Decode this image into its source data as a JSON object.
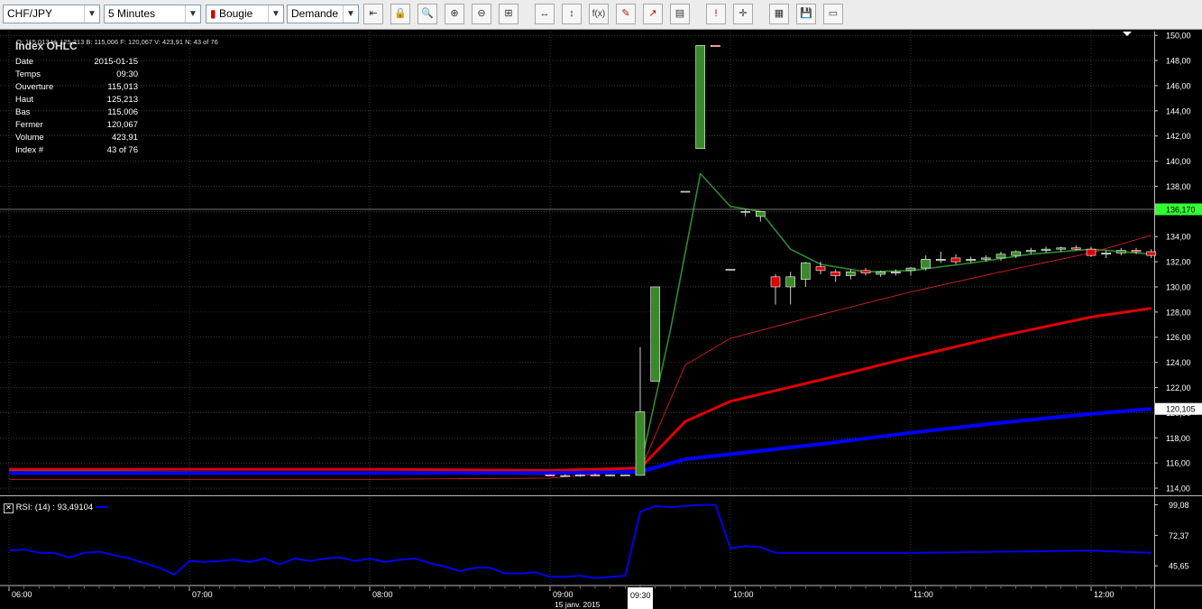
{
  "toolbar": {
    "symbol": "CHF/JPY",
    "timeframe": "5 Minutes",
    "chart_type": "Bougie",
    "price_side": "Demande"
  },
  "info_bar": "O: 115,013 H: 125,213 B: 115,006 F: 120,067 V: 423,91 N: 43 of 76",
  "ohlc_title": "Index OHLC",
  "ohlc_rows": [
    {
      "label": "Date",
      "value": "2015-01-15"
    },
    {
      "label": "Temps",
      "value": "09:30"
    },
    {
      "label": "Ouverture",
      "value": "115,013"
    },
    {
      "label": "Haut",
      "value": "125,213"
    },
    {
      "label": "Bas",
      "value": "115,006"
    },
    {
      "label": "Fermer",
      "value": "120,067"
    },
    {
      "label": "Volume",
      "value": "423,91"
    },
    {
      "label": "Index #",
      "value": "43 of 76"
    }
  ],
  "crosshair_price": "136,170",
  "last_price": "120,105",
  "rsi_label": "RSI: (14) : 93,49104",
  "cursor_time": "09:30",
  "date_label": "15 janv. 2015",
  "colors": {
    "up": "#3a8a2a",
    "down": "#e00000",
    "ma_green": "#2e8b2e",
    "ma_thin_red": "#d42020",
    "ma_red": "#e00000",
    "ma_blue": "#0000ff",
    "rsi": "#0000ee",
    "grid": "#5a5a5a",
    "highlight": "#33ff33"
  },
  "chart_data": [
    {
      "type": "candlestick",
      "x_unit": "time (5-minute bars)",
      "x_ticks": [
        "06:00",
        "07:00",
        "08:00",
        "09:00",
        "10:00",
        "11:00",
        "12:00"
      ],
      "y_ticks": [
        "114,00",
        "116,00",
        "118,00",
        "120,00",
        "122,00",
        "124,00",
        "126,00",
        "128,00",
        "130,00",
        "132,00",
        "134,00",
        "136,00",
        "138,00",
        "140,00",
        "142,00",
        "144,00",
        "146,00",
        "148,00",
        "150,00"
      ],
      "ylim": [
        113.5,
        150.3
      ],
      "grid": true,
      "candles": [
        {
          "t": "09:00",
          "o": 115.05,
          "h": 115.1,
          "l": 114.95,
          "c": 115.0
        },
        {
          "t": "09:05",
          "o": 115.0,
          "h": 115.1,
          "l": 114.9,
          "c": 115.0
        },
        {
          "t": "09:10",
          "o": 115.0,
          "h": 115.1,
          "l": 114.9,
          "c": 115.05
        },
        {
          "t": "09:15",
          "o": 115.05,
          "h": 115.15,
          "l": 114.95,
          "c": 115.0
        },
        {
          "t": "09:20",
          "o": 115.0,
          "h": 115.1,
          "l": 114.95,
          "c": 115.05
        },
        {
          "t": "09:25",
          "o": 115.05,
          "h": 115.1,
          "l": 115.0,
          "c": 115.05
        },
        {
          "t": "09:30",
          "o": 115.013,
          "h": 125.213,
          "l": 115.006,
          "c": 120.067
        },
        {
          "t": "09:35",
          "o": 122.5,
          "h": 126.6,
          "l": 122.5,
          "c": 130.0
        },
        {
          "t": "09:45",
          "o": 137.6,
          "h": 137.6,
          "l": 137.6,
          "c": 137.6
        },
        {
          "t": "09:50",
          "o": 141.0,
          "h": 149.2,
          "l": 141.0,
          "c": 149.2
        },
        {
          "t": "09:55",
          "o": 149.2,
          "h": 149.2,
          "l": 149.1,
          "c": 149.1
        },
        {
          "t": "10:00",
          "o": 131.4,
          "h": 131.4,
          "l": 131.4,
          "c": 131.4
        },
        {
          "t": "10:05",
          "o": 136.0,
          "h": 136.2,
          "l": 135.6,
          "c": 136.0
        },
        {
          "t": "10:10",
          "o": 135.6,
          "h": 136.0,
          "l": 135.2,
          "c": 136.0
        },
        {
          "t": "10:15",
          "o": 130.8,
          "h": 131.0,
          "l": 128.6,
          "c": 130.0
        },
        {
          "t": "10:20",
          "o": 130.0,
          "h": 131.2,
          "l": 128.6,
          "c": 130.8
        },
        {
          "t": "10:25",
          "o": 130.6,
          "h": 132.0,
          "l": 130.0,
          "c": 131.9
        },
        {
          "t": "10:30",
          "o": 131.6,
          "h": 132.0,
          "l": 131.0,
          "c": 131.3
        },
        {
          "t": "10:35",
          "o": 131.2,
          "h": 131.4,
          "l": 130.4,
          "c": 130.9
        },
        {
          "t": "10:40",
          "o": 130.9,
          "h": 131.4,
          "l": 130.6,
          "c": 131.2
        },
        {
          "t": "10:45",
          "o": 131.3,
          "h": 131.5,
          "l": 130.9,
          "c": 131.1
        },
        {
          "t": "10:50",
          "o": 131.0,
          "h": 131.3,
          "l": 130.8,
          "c": 131.2
        },
        {
          "t": "10:55",
          "o": 131.1,
          "h": 131.4,
          "l": 130.9,
          "c": 131.2
        },
        {
          "t": "11:00",
          "o": 131.3,
          "h": 131.6,
          "l": 130.9,
          "c": 131.5
        },
        {
          "t": "11:05",
          "o": 131.5,
          "h": 132.5,
          "l": 131.3,
          "c": 132.2
        },
        {
          "t": "11:10",
          "o": 132.1,
          "h": 132.8,
          "l": 131.9,
          "c": 132.2
        },
        {
          "t": "11:15",
          "o": 132.3,
          "h": 132.6,
          "l": 131.8,
          "c": 132.0
        },
        {
          "t": "11:20",
          "o": 132.1,
          "h": 132.4,
          "l": 131.9,
          "c": 132.2
        },
        {
          "t": "11:25",
          "o": 132.2,
          "h": 132.5,
          "l": 132.0,
          "c": 132.3
        },
        {
          "t": "11:30",
          "o": 132.3,
          "h": 132.8,
          "l": 132.1,
          "c": 132.6
        },
        {
          "t": "11:35",
          "o": 132.5,
          "h": 132.9,
          "l": 132.3,
          "c": 132.8
        },
        {
          "t": "11:40",
          "o": 132.8,
          "h": 133.1,
          "l": 132.6,
          "c": 132.9
        },
        {
          "t": "11:45",
          "o": 132.9,
          "h": 133.2,
          "l": 132.7,
          "c": 133.0
        },
        {
          "t": "11:50",
          "o": 133.0,
          "h": 133.2,
          "l": 132.8,
          "c": 133.1
        },
        {
          "t": "11:55",
          "o": 133.1,
          "h": 133.3,
          "l": 132.9,
          "c": 133.0
        },
        {
          "t": "12:00",
          "o": 133.0,
          "h": 133.2,
          "l": 132.4,
          "c": 132.5
        },
        {
          "t": "12:05",
          "o": 132.6,
          "h": 132.9,
          "l": 132.3,
          "c": 132.7
        },
        {
          "t": "12:10",
          "o": 132.7,
          "h": 133.1,
          "l": 132.5,
          "c": 132.9
        },
        {
          "t": "12:15",
          "o": 132.9,
          "h": 133.1,
          "l": 132.6,
          "c": 132.8
        },
        {
          "t": "12:20",
          "o": 132.8,
          "h": 133.0,
          "l": 132.3,
          "c": 132.5
        }
      ],
      "overlays": [
        {
          "color": "#2e8b2e",
          "width": 1.6,
          "points": [
            [
              "06:00",
              115.4
            ],
            [
              "07:00",
              115.3
            ],
            [
              "08:00",
              115.2
            ],
            [
              "09:00",
              115.1
            ],
            [
              "09:30",
              115.6
            ],
            [
              "09:40",
              126.5
            ],
            [
              "09:50",
              139.0
            ],
            [
              "10:00",
              136.4
            ],
            [
              "10:10",
              136.0
            ],
            [
              "10:20",
              133.0
            ],
            [
              "10:30",
              131.8
            ],
            [
              "10:45",
              131.2
            ],
            [
              "11:00",
              131.3
            ],
            [
              "11:20",
              131.9
            ],
            [
              "11:40",
              132.6
            ],
            [
              "12:00",
              133.0
            ],
            [
              "12:20",
              132.6
            ]
          ]
        },
        {
          "color": "#d42020",
          "width": 0.9,
          "points": [
            [
              "06:00",
              114.7
            ],
            [
              "07:00",
              114.7
            ],
            [
              "08:00",
              114.7
            ],
            [
              "09:00",
              114.8
            ],
            [
              "09:30",
              115.4
            ],
            [
              "09:45",
              123.8
            ],
            [
              "10:00",
              125.9
            ],
            [
              "10:30",
              127.8
            ],
            [
              "11:00",
              129.6
            ],
            [
              "11:30",
              131.2
            ],
            [
              "12:00",
              132.7
            ],
            [
              "12:20",
              134.1
            ]
          ]
        },
        {
          "color": "#e00000",
          "width": 3,
          "points": [
            [
              "06:00",
              115.5
            ],
            [
              "07:00",
              115.5
            ],
            [
              "08:00",
              115.5
            ],
            [
              "09:00",
              115.4
            ],
            [
              "09:30",
              115.6
            ],
            [
              "09:45",
              119.3
            ],
            [
              "10:00",
              120.9
            ],
            [
              "10:30",
              122.6
            ],
            [
              "11:00",
              124.4
            ],
            [
              "11:30",
              126.1
            ],
            [
              "12:00",
              127.6
            ],
            [
              "12:20",
              128.3
            ]
          ]
        },
        {
          "color": "#0000ff",
          "width": 4,
          "points": [
            [
              "06:00",
              115.2
            ],
            [
              "07:00",
              115.2
            ],
            [
              "08:00",
              115.2
            ],
            [
              "09:00",
              115.2
            ],
            [
              "09:30",
              115.3
            ],
            [
              "09:45",
              116.3
            ],
            [
              "10:00",
              116.7
            ],
            [
              "10:30",
              117.5
            ],
            [
              "11:00",
              118.4
            ],
            [
              "11:30",
              119.2
            ],
            [
              "12:00",
              119.9
            ],
            [
              "12:20",
              120.3
            ]
          ]
        }
      ],
      "crosshair": {
        "time": "09:30",
        "price": 136.17
      }
    },
    {
      "type": "line",
      "x_ticks": [
        "06:00",
        "07:00",
        "08:00",
        "09:00",
        "10:00",
        "11:00",
        "12:00"
      ],
      "y_ticks": [
        "99,08",
        "72,37",
        "45,65"
      ],
      "ylim": [
        30,
        105
      ],
      "series": [
        {
          "name": "RSI: (14)",
          "color": "#0000ee",
          "points": [
            [
              "06:00",
              59
            ],
            [
              "06:05",
              60
            ],
            [
              "06:10",
              57
            ],
            [
              "06:15",
              57
            ],
            [
              "06:20",
              53
            ],
            [
              "06:25",
              57
            ],
            [
              "06:30",
              58
            ],
            [
              "06:35",
              55
            ],
            [
              "06:40",
              52
            ],
            [
              "06:45",
              48
            ],
            [
              "06:50",
              44
            ],
            [
              "06:55",
              38
            ],
            [
              "07:00",
              50
            ],
            [
              "07:05",
              49
            ],
            [
              "07:10",
              50
            ],
            [
              "07:15",
              51
            ],
            [
              "07:20",
              49
            ],
            [
              "07:25",
              52
            ],
            [
              "07:30",
              47
            ],
            [
              "07:35",
              52
            ],
            [
              "07:40",
              50
            ],
            [
              "07:45",
              52
            ],
            [
              "07:50",
              53
            ],
            [
              "07:55",
              50
            ],
            [
              "08:00",
              52
            ],
            [
              "08:05",
              49
            ],
            [
              "08:10",
              51
            ],
            [
              "08:15",
              52
            ],
            [
              "08:20",
              48
            ],
            [
              "08:25",
              45
            ],
            [
              "08:30",
              41
            ],
            [
              "08:35",
              44
            ],
            [
              "08:40",
              44
            ],
            [
              "08:45",
              39
            ],
            [
              "08:50",
              39
            ],
            [
              "08:55",
              40
            ],
            [
              "09:00",
              36
            ],
            [
              "09:05",
              36
            ],
            [
              "09:10",
              37
            ],
            [
              "09:15",
              35
            ],
            [
              "09:20",
              36
            ],
            [
              "09:25",
              37
            ],
            [
              "09:30",
              93
            ],
            [
              "09:35",
              98
            ],
            [
              "09:40",
              97
            ],
            [
              "09:45",
              98
            ],
            [
              "09:50",
              99
            ],
            [
              "09:55",
              99
            ],
            [
              "10:00",
              61
            ],
            [
              "10:05",
              63
            ],
            [
              "10:10",
              62
            ],
            [
              "10:15",
              57
            ],
            [
              "10:20",
              57
            ],
            [
              "10:25",
              57
            ],
            [
              "10:30",
              57
            ],
            [
              "10:45",
              57
            ],
            [
              "11:00",
              57
            ],
            [
              "11:30",
              58
            ],
            [
              "12:00",
              59
            ],
            [
              "12:20",
              57
            ]
          ]
        }
      ]
    }
  ]
}
